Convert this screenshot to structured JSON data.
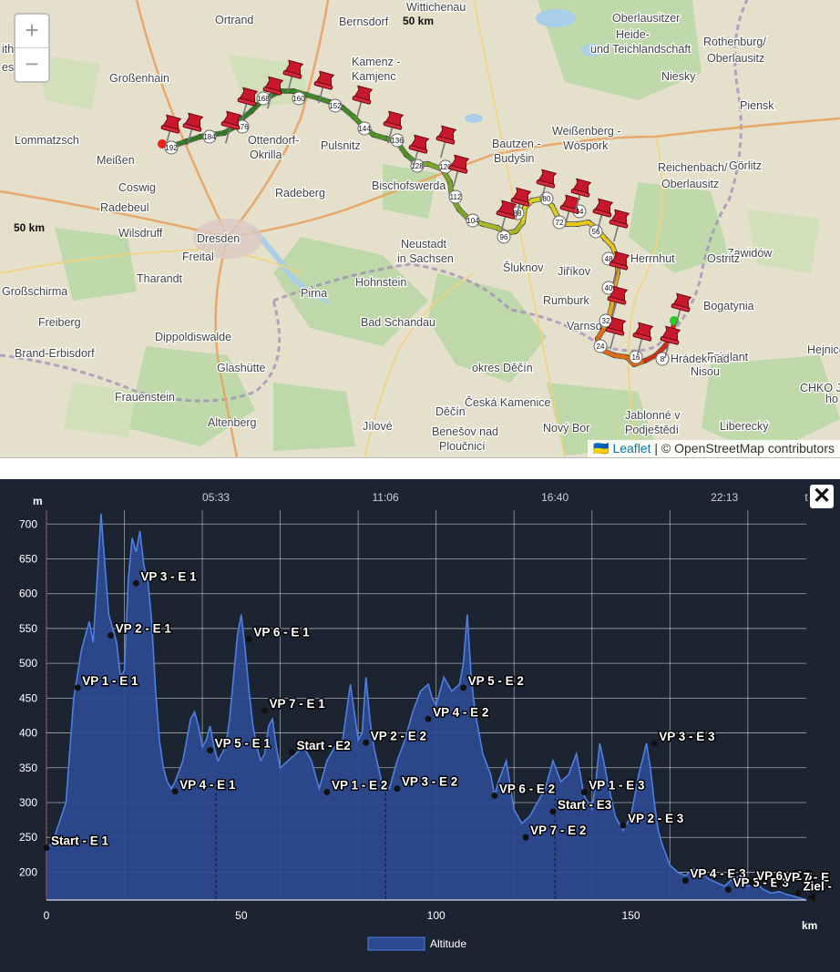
{
  "map": {
    "zoom_in": "+",
    "zoom_out": "−",
    "attribution": {
      "flag": "🇺🇦",
      "leaflet": "Leaflet",
      "separator": " | ",
      "osm": "© OpenStreetMap contributors"
    },
    "scale_label_top": "50 km",
    "scale_label_left": "50 km",
    "places": [
      {
        "name": "Wittichenau"
      },
      {
        "name": "Ortrand"
      },
      {
        "name": "Bernsdorf"
      },
      {
        "name": "Oberlausitzer"
      },
      {
        "name": "Heide-"
      },
      {
        "name": "und Teichlandschaft"
      },
      {
        "name": "Rothenburg/"
      },
      {
        "name": "Oberlausitz"
      },
      {
        "name": "Großenhain"
      },
      {
        "name": "Niesky"
      },
      {
        "name": "Kamenz -"
      },
      {
        "name": "Kamjenc"
      },
      {
        "name": "Piensk"
      },
      {
        "name": "Lommatzsch"
      },
      {
        "name": "Weißenberg -"
      },
      {
        "name": "Wóspork"
      },
      {
        "name": "Ottendorf-"
      },
      {
        "name": "Okrilla"
      },
      {
        "name": "Pulsnitz"
      },
      {
        "name": "Bautzen -"
      },
      {
        "name": "Budyšin"
      },
      {
        "name": "Meißen"
      },
      {
        "name": "Görlitz"
      },
      {
        "name": "Reichenbach/"
      },
      {
        "name": "Oberlausitz"
      },
      {
        "name": "Coswig"
      },
      {
        "name": "Radeberg"
      },
      {
        "name": "Bischofswerda"
      },
      {
        "name": "Radebeul"
      },
      {
        "name": "Wilsdruff"
      },
      {
        "name": "Dresden"
      },
      {
        "name": "Zawidów"
      },
      {
        "name": "Neustadt"
      },
      {
        "name": "in Sachsen"
      },
      {
        "name": "Šluknov"
      },
      {
        "name": "Jiříkov"
      },
      {
        "name": "Herrnhut"
      },
      {
        "name": "Ostritz"
      },
      {
        "name": "Freital"
      },
      {
        "name": "Tharandt"
      },
      {
        "name": "Großschirma"
      },
      {
        "name": "Hohnstein"
      },
      {
        "name": "Pirna"
      },
      {
        "name": "Rumburk"
      },
      {
        "name": "Freiberg"
      },
      {
        "name": "Bad Schandau"
      },
      {
        "name": "Bogatynia"
      },
      {
        "name": "Dippoldiswalde"
      },
      {
        "name": "Varnsdorf"
      },
      {
        "name": "Brand-Erbisdorf"
      },
      {
        "name": "Hejnice"
      },
      {
        "name": "Glashütte"
      },
      {
        "name": "okres Děčín"
      },
      {
        "name": "Frýdlant"
      },
      {
        "name": "Hrádek nad"
      },
      {
        "name": "Nisou"
      },
      {
        "name": "Frauenstein"
      },
      {
        "name": "Česká Kamenice"
      },
      {
        "name": "CHKO J"
      },
      {
        "name": "ho"
      },
      {
        "name": "Altenberg"
      },
      {
        "name": "Jílové"
      },
      {
        "name": "Děčín"
      },
      {
        "name": "Jablonné v"
      },
      {
        "name": "Podještědí"
      },
      {
        "name": "Liberecký"
      },
      {
        "name": "Benešov nad"
      },
      {
        "name": "Ploučnicí"
      },
      {
        "name": "Nový Bor"
      },
      {
        "name": "esa"
      },
      {
        "name": "ithain"
      }
    ],
    "route_km_labels": [
      "192",
      "184",
      "176",
      "168",
      "160",
      "152",
      "144",
      "136",
      "128",
      "120",
      "112",
      "104",
      "96",
      "88",
      "80",
      "72",
      "64",
      "56",
      "48",
      "40",
      "32",
      "24",
      "16",
      "8"
    ]
  },
  "profile": {
    "close_label": "✕",
    "y_unit": "m",
    "x_unit": "km",
    "time_unit": "t",
    "legend_label": "Altitude",
    "colors": {
      "area": "#2c4a8f",
      "line": "#4f7fe0",
      "background": "#1c2431"
    }
  },
  "chart_data": {
    "type": "area",
    "title": "",
    "xlabel": "km",
    "ylabel": "m",
    "xlim": [
      0,
      195
    ],
    "ylim": [
      160,
      720
    ],
    "x_ticks": [
      0,
      50,
      100,
      150
    ],
    "y_ticks": [
      200,
      250,
      300,
      350,
      400,
      450,
      500,
      550,
      600,
      650,
      700
    ],
    "time_ticks": [
      {
        "label": "05:33",
        "km": 43.5
      },
      {
        "label": "11:06",
        "km": 87
      },
      {
        "label": "16:40",
        "km": 130.5
      },
      {
        "label": "22:13",
        "km": 174
      },
      {
        "label": "t",
        "km": 195
      }
    ],
    "series": [
      {
        "name": "Altitude",
        "x": [
          0,
          2,
          5,
          7,
          9,
          11,
          12,
          13,
          14,
          15,
          16,
          17,
          18,
          19,
          20,
          21,
          22,
          23,
          24,
          25,
          26,
          27,
          28,
          29,
          30,
          31,
          32,
          33,
          35,
          37,
          38,
          39,
          40,
          41,
          42,
          43,
          44,
          46,
          47,
          48,
          49,
          50,
          51,
          52,
          53,
          54,
          55,
          56,
          57,
          58,
          59,
          60,
          62,
          64,
          66,
          68,
          70,
          72,
          74,
          76,
          78,
          79,
          80,
          81,
          82,
          83,
          84,
          86,
          88,
          90,
          92,
          94,
          96,
          98,
          99,
          100,
          102,
          104,
          106,
          107,
          108,
          109,
          110,
          111,
          112,
          114,
          115,
          116,
          118,
          120,
          122,
          124,
          126,
          128,
          130,
          132,
          134,
          136,
          138,
          140,
          141,
          142,
          143,
          144,
          146,
          148,
          150,
          152,
          154,
          155,
          156,
          157,
          158,
          160,
          162,
          164,
          166,
          168,
          170,
          172,
          174,
          176,
          178,
          180,
          182,
          184,
          186,
          188,
          190,
          192,
          195
        ],
        "values": [
          230,
          250,
          300,
          450,
          520,
          560,
          530,
          620,
          715,
          640,
          570,
          550,
          530,
          480,
          490,
          620,
          680,
          660,
          690,
          640,
          620,
          560,
          460,
          390,
          350,
          330,
          320,
          330,
          360,
          420,
          430,
          410,
          380,
          390,
          410,
          380,
          360,
          380,
          420,
          480,
          540,
          570,
          520,
          460,
          410,
          380,
          360,
          370,
          410,
          420,
          380,
          350,
          360,
          370,
          380,
          360,
          320,
          360,
          380,
          390,
          470,
          430,
          390,
          400,
          480,
          420,
          380,
          330,
          320,
          360,
          390,
          430,
          460,
          470,
          450,
          440,
          480,
          460,
          470,
          500,
          570,
          480,
          430,
          400,
          370,
          340,
          310,
          330,
          360,
          290,
          270,
          280,
          300,
          320,
          360,
          330,
          340,
          370,
          310,
          290,
          330,
          385,
          360,
          330,
          280,
          260,
          280,
          340,
          385,
          350,
          300,
          260,
          240,
          210,
          200,
          195,
          205,
          200,
          190,
          185,
          180,
          190,
          195,
          180,
          185,
          175,
          170,
          172,
          168,
          165,
          160
        ]
      }
    ],
    "annotations": [
      {
        "label": "Start - E 1",
        "km": 0,
        "alt": 235
      },
      {
        "label": "VP 1 - E 1",
        "km": 8,
        "alt": 465
      },
      {
        "label": "VP 2 - E 1",
        "km": 16.5,
        "alt": 540
      },
      {
        "label": "VP 3 - E 1",
        "km": 23,
        "alt": 615
      },
      {
        "label": "VP 4 - E 1",
        "km": 33,
        "alt": 316
      },
      {
        "label": "VP 5 - E 1",
        "km": 42,
        "alt": 375
      },
      {
        "label": "VP 6 - E 1",
        "km": 52,
        "alt": 535
      },
      {
        "label": "VP 7 - E 1",
        "km": 56,
        "alt": 432
      },
      {
        "label": "Start - E2",
        "km": 63,
        "alt": 372
      },
      {
        "label": "VP 1 - E 2",
        "km": 72,
        "alt": 315
      },
      {
        "label": "VP 2 - E 2",
        "km": 82,
        "alt": 386
      },
      {
        "label": "VP 3 - E 2",
        "km": 90,
        "alt": 320
      },
      {
        "label": "VP 4 - E 2",
        "km": 98,
        "alt": 420
      },
      {
        "label": "VP 5 - E 2",
        "km": 107,
        "alt": 465
      },
      {
        "label": "VP 6 - E 2",
        "km": 115,
        "alt": 310
      },
      {
        "label": "VP 7 - E 2",
        "km": 123,
        "alt": 250
      },
      {
        "label": "Start - E3",
        "km": 130,
        "alt": 287
      },
      {
        "label": "VP 1 - E 3",
        "km": 138,
        "alt": 315
      },
      {
        "label": "VP 2 - E 3",
        "km": 148,
        "alt": 267
      },
      {
        "label": "VP 3 - E 3",
        "km": 156,
        "alt": 385
      },
      {
        "label": "VP 4 - E 3",
        "km": 164,
        "alt": 188
      },
      {
        "label": "VP 5 - E 3",
        "km": 175,
        "alt": 175
      },
      {
        "label": "VP 6 - E 3",
        "km": 181,
        "alt": 185
      },
      {
        "label": "VP 7 - E",
        "km": 188,
        "alt": 183
      },
      {
        "label": "Ziel -",
        "km": 193,
        "alt": 170
      }
    ]
  }
}
